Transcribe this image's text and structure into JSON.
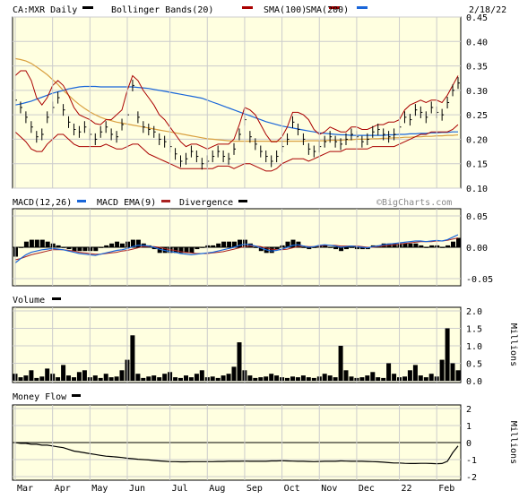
{
  "chart_data": {
    "type": "stock-panels",
    "symbol_label": "CA:MXR Daily",
    "date_label": "2/18/22",
    "watermark": "©BigCharts.com",
    "colors": {
      "background": "#ffffe0",
      "grid": "#cccccc",
      "price": "#000000",
      "bollinger": "#aa0000",
      "sma100": "#aa0000",
      "sma200": "#d9a040",
      "macd": "#1a66d9",
      "macd_ema": "#aa2222",
      "divergence": "#000000",
      "volume": "#000000",
      "money_flow": "#000000"
    },
    "legend": [
      {
        "label": "Bollinger Bands(20)",
        "color": "#aa0000"
      },
      {
        "label": "SMA(100)",
        "color": "#aa0000"
      },
      {
        "label": "SMA(200)",
        "color": "#d9a040"
      }
    ],
    "x_months": [
      "Mar",
      "Apr",
      "May",
      "Jun",
      "Jul",
      "Aug",
      "Sep",
      "Oct",
      "Nov",
      "Dec",
      "22",
      "Feb"
    ],
    "price_panel": {
      "ylim": [
        0.1,
        0.45
      ],
      "ticks": [
        "0.45",
        "0.40",
        "0.35",
        "0.30",
        "0.25",
        "0.20",
        "0.15",
        "0.10"
      ],
      "close": [
        0.28,
        0.265,
        0.245,
        0.225,
        0.205,
        0.21,
        0.245,
        0.265,
        0.285,
        0.26,
        0.235,
        0.22,
        0.215,
        0.225,
        0.21,
        0.2,
        0.215,
        0.225,
        0.21,
        0.205,
        0.23,
        0.25,
        0.31,
        0.245,
        0.225,
        0.22,
        0.215,
        0.2,
        0.195,
        0.185,
        0.17,
        0.155,
        0.16,
        0.175,
        0.165,
        0.15,
        0.155,
        0.165,
        0.175,
        0.165,
        0.16,
        0.18,
        0.21,
        0.24,
        0.205,
        0.19,
        0.175,
        0.165,
        0.155,
        0.165,
        0.185,
        0.2,
        0.235,
        0.22,
        0.2,
        0.18,
        0.175,
        0.185,
        0.195,
        0.205,
        0.195,
        0.19,
        0.2,
        0.21,
        0.205,
        0.195,
        0.2,
        0.215,
        0.22,
        0.21,
        0.205,
        0.21,
        0.225,
        0.245,
        0.24,
        0.26,
        0.255,
        0.245,
        0.265,
        0.255,
        0.25,
        0.275,
        0.3,
        0.315
      ],
      "sma200": [
        0.365,
        0.363,
        0.36,
        0.355,
        0.348,
        0.34,
        0.332,
        0.322,
        0.312,
        0.3,
        0.29,
        0.28,
        0.271,
        0.263,
        0.256,
        0.25,
        0.245,
        0.241,
        0.238,
        0.235,
        0.233,
        0.231,
        0.229,
        0.227,
        0.225,
        0.223,
        0.221,
        0.219,
        0.217,
        0.215,
        0.213,
        0.211,
        0.209,
        0.207,
        0.205,
        0.203,
        0.201,
        0.2,
        0.199,
        0.198,
        0.197,
        0.196,
        0.196,
        0.196,
        0.196,
        0.196,
        0.196,
        0.196,
        0.196,
        0.196,
        0.196,
        0.196,
        0.196,
        0.196,
        0.196,
        0.197,
        0.197,
        0.197,
        0.197,
        0.198,
        0.198,
        0.198,
        0.199,
        0.199,
        0.2,
        0.2,
        0.2,
        0.201,
        0.201,
        0.202,
        0.202,
        0.203,
        0.203,
        0.204,
        0.204,
        0.205,
        0.205,
        0.206,
        0.206,
        0.207,
        0.207,
        0.208,
        0.208,
        0.209
      ],
      "sma100": [
        0.27,
        0.272,
        0.275,
        0.278,
        0.282,
        0.286,
        0.29,
        0.294,
        0.297,
        0.3,
        0.303,
        0.305,
        0.307,
        0.308,
        0.308,
        0.308,
        0.307,
        0.307,
        0.307,
        0.307,
        0.307,
        0.307,
        0.307,
        0.306,
        0.305,
        0.304,
        0.302,
        0.3,
        0.298,
        0.296,
        0.294,
        0.292,
        0.29,
        0.288,
        0.286,
        0.284,
        0.28,
        0.276,
        0.272,
        0.268,
        0.264,
        0.26,
        0.256,
        0.252,
        0.248,
        0.244,
        0.24,
        0.236,
        0.233,
        0.23,
        0.227,
        0.225,
        0.223,
        0.221,
        0.219,
        0.217,
        0.215,
        0.213,
        0.212,
        0.211,
        0.21,
        0.209,
        0.209,
        0.208,
        0.208,
        0.208,
        0.208,
        0.208,
        0.208,
        0.208,
        0.209,
        0.209,
        0.21,
        0.21,
        0.211,
        0.211,
        0.212,
        0.212,
        0.213,
        0.213,
        0.214,
        0.214,
        0.215,
        0.215
      ],
      "bb_upper": [
        0.33,
        0.34,
        0.34,
        0.32,
        0.285,
        0.27,
        0.285,
        0.31,
        0.32,
        0.31,
        0.29,
        0.265,
        0.25,
        0.245,
        0.24,
        0.232,
        0.23,
        0.24,
        0.24,
        0.25,
        0.26,
        0.3,
        0.33,
        0.32,
        0.3,
        0.285,
        0.27,
        0.25,
        0.24,
        0.225,
        0.21,
        0.195,
        0.185,
        0.19,
        0.19,
        0.185,
        0.18,
        0.185,
        0.19,
        0.19,
        0.19,
        0.2,
        0.23,
        0.265,
        0.26,
        0.25,
        0.23,
        0.21,
        0.195,
        0.195,
        0.205,
        0.225,
        0.255,
        0.255,
        0.25,
        0.24,
        0.22,
        0.21,
        0.215,
        0.225,
        0.22,
        0.215,
        0.215,
        0.225,
        0.225,
        0.22,
        0.22,
        0.225,
        0.23,
        0.23,
        0.235,
        0.235,
        0.24,
        0.26,
        0.27,
        0.275,
        0.28,
        0.275,
        0.28,
        0.28,
        0.275,
        0.29,
        0.31,
        0.33
      ],
      "bb_lower": [
        0.215,
        0.205,
        0.195,
        0.18,
        0.175,
        0.175,
        0.19,
        0.2,
        0.21,
        0.21,
        0.2,
        0.19,
        0.185,
        0.185,
        0.185,
        0.185,
        0.185,
        0.19,
        0.185,
        0.18,
        0.18,
        0.185,
        0.19,
        0.19,
        0.18,
        0.17,
        0.165,
        0.16,
        0.155,
        0.15,
        0.145,
        0.14,
        0.14,
        0.14,
        0.14,
        0.14,
        0.14,
        0.14,
        0.145,
        0.145,
        0.145,
        0.14,
        0.145,
        0.15,
        0.15,
        0.145,
        0.14,
        0.135,
        0.135,
        0.14,
        0.15,
        0.155,
        0.16,
        0.16,
        0.16,
        0.155,
        0.16,
        0.165,
        0.17,
        0.175,
        0.175,
        0.175,
        0.18,
        0.18,
        0.18,
        0.18,
        0.18,
        0.185,
        0.185,
        0.185,
        0.185,
        0.185,
        0.19,
        0.195,
        0.2,
        0.205,
        0.21,
        0.21,
        0.215,
        0.215,
        0.215,
        0.215,
        0.22,
        0.23
      ]
    },
    "macd_panel": {
      "legend": [
        {
          "label": "MACD(12,26)",
          "color": "#1a66d9"
        },
        {
          "label": "MACD EMA(9)",
          "color": "#aa2222"
        },
        {
          "label": "Divergence",
          "color": "#000000"
        }
      ],
      "ylim": [
        -0.05,
        0.05
      ],
      "ticks": [
        "0.05",
        "0.00",
        "-0.05"
      ],
      "macd": [
        -0.025,
        -0.018,
        -0.012,
        -0.008,
        -0.006,
        -0.004,
        -0.003,
        -0.002,
        -0.003,
        -0.004,
        -0.006,
        -0.008,
        -0.01,
        -0.011,
        -0.012,
        -0.013,
        -0.011,
        -0.009,
        -0.007,
        -0.005,
        -0.004,
        -0.002,
        0.001,
        0.003,
        0.003,
        0.002,
        0.0,
        -0.003,
        -0.005,
        -0.007,
        -0.008,
        -0.01,
        -0.011,
        -0.012,
        -0.011,
        -0.01,
        -0.009,
        -0.008,
        -0.006,
        -0.004,
        -0.002,
        0.0,
        0.003,
        0.005,
        0.004,
        0.002,
        -0.001,
        -0.004,
        -0.006,
        -0.005,
        -0.003,
        0.0,
        0.003,
        0.004,
        0.002,
        0.0,
        0.001,
        0.003,
        0.004,
        0.003,
        0.002,
        0.0,
        0.001,
        0.002,
        0.001,
        0.0,
        -0.001,
        0.001,
        0.002,
        0.004,
        0.005,
        0.006,
        0.007,
        0.008,
        0.009,
        0.01,
        0.01,
        0.009,
        0.01,
        0.011,
        0.01,
        0.012,
        0.016,
        0.02
      ],
      "signal": [
        -0.02,
        -0.018,
        -0.015,
        -0.012,
        -0.01,
        -0.008,
        -0.006,
        -0.004,
        -0.004,
        -0.004,
        -0.005,
        -0.006,
        -0.008,
        -0.009,
        -0.01,
        -0.011,
        -0.011,
        -0.01,
        -0.009,
        -0.008,
        -0.006,
        -0.005,
        -0.003,
        -0.001,
        0.001,
        0.001,
        0.001,
        0.0,
        -0.002,
        -0.004,
        -0.005,
        -0.007,
        -0.008,
        -0.009,
        -0.01,
        -0.01,
        -0.01,
        -0.009,
        -0.008,
        -0.007,
        -0.005,
        -0.003,
        -0.001,
        0.001,
        0.002,
        0.002,
        0.001,
        -0.001,
        -0.003,
        -0.004,
        -0.004,
        -0.003,
        -0.001,
        0.001,
        0.002,
        0.001,
        0.001,
        0.002,
        0.003,
        0.003,
        0.003,
        0.002,
        0.002,
        0.002,
        0.002,
        0.001,
        0.0,
        0.0,
        0.001,
        0.002,
        0.003,
        0.004,
        0.005,
        0.006,
        0.007,
        0.008,
        0.009,
        0.009,
        0.009,
        0.01,
        0.01,
        0.011,
        0.013,
        0.015
      ]
    },
    "volume_panel": {
      "title": "Volume",
      "ylim": [
        0.0,
        2.0
      ],
      "ticks": [
        "2.0",
        "1.5",
        "1.0",
        "0.5",
        "0.0"
      ],
      "unit_label": "Millions",
      "values": [
        0.2,
        0.1,
        0.15,
        0.3,
        0.08,
        0.12,
        0.35,
        0.2,
        0.1,
        0.45,
        0.15,
        0.1,
        0.25,
        0.3,
        0.1,
        0.15,
        0.08,
        0.2,
        0.1,
        0.12,
        0.3,
        0.6,
        1.3,
        0.2,
        0.08,
        0.12,
        0.15,
        0.1,
        0.2,
        0.25,
        0.1,
        0.08,
        0.15,
        0.1,
        0.2,
        0.3,
        0.1,
        0.12,
        0.08,
        0.15,
        0.2,
        0.4,
        1.1,
        0.3,
        0.15,
        0.08,
        0.1,
        0.12,
        0.2,
        0.15,
        0.1,
        0.08,
        0.12,
        0.1,
        0.15,
        0.1,
        0.08,
        0.12,
        0.2,
        0.15,
        0.1,
        1.0,
        0.3,
        0.12,
        0.08,
        0.1,
        0.15,
        0.25,
        0.1,
        0.08,
        0.5,
        0.2,
        0.1,
        0.12,
        0.3,
        0.45,
        0.15,
        0.1,
        0.2,
        0.12,
        0.6,
        1.5,
        0.5,
        0.3
      ]
    },
    "money_flow_panel": {
      "title": "Money Flow",
      "ylim": [
        -2,
        2
      ],
      "ticks": [
        "2",
        "1",
        "0",
        "-1",
        "-2"
      ],
      "unit_label": "Millions",
      "values": [
        0.0,
        -0.05,
        -0.05,
        -0.1,
        -0.1,
        -0.15,
        -0.15,
        -0.2,
        -0.25,
        -0.3,
        -0.4,
        -0.5,
        -0.55,
        -0.6,
        -0.65,
        -0.7,
        -0.75,
        -0.8,
        -0.82,
        -0.85,
        -0.88,
        -0.92,
        -0.95,
        -0.98,
        -1.0,
        -1.02,
        -1.05,
        -1.08,
        -1.1,
        -1.12,
        -1.12,
        -1.13,
        -1.13,
        -1.12,
        -1.12,
        -1.12,
        -1.12,
        -1.12,
        -1.11,
        -1.11,
        -1.1,
        -1.1,
        -1.1,
        -1.09,
        -1.1,
        -1.1,
        -1.1,
        -1.1,
        -1.08,
        -1.08,
        -1.07,
        -1.08,
        -1.09,
        -1.1,
        -1.1,
        -1.11,
        -1.12,
        -1.11,
        -1.1,
        -1.1,
        -1.1,
        -1.08,
        -1.09,
        -1.1,
        -1.1,
        -1.1,
        -1.11,
        -1.12,
        -1.13,
        -1.15,
        -1.18,
        -1.2,
        -1.2,
        -1.22,
        -1.23,
        -1.23,
        -1.22,
        -1.22,
        -1.23,
        -1.24,
        -1.23,
        -1.1,
        -0.6,
        -0.2
      ]
    }
  }
}
